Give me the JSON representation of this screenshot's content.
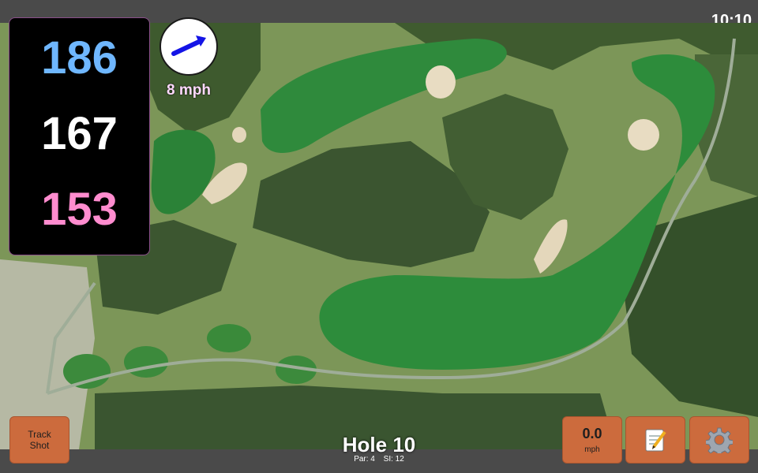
{
  "status": {
    "time": "10:10"
  },
  "distances": {
    "back": "186",
    "middle": "167",
    "front": "153",
    "back_color": "#6fb7ff",
    "middle_color": "#ffffff",
    "front_color": "#ff8ccf"
  },
  "wind": {
    "speed": "8 mph",
    "direction_icon": "arrow-up-right-icon",
    "arrow_color": "#1414e6"
  },
  "map": {
    "type": "satellite-golf-hole",
    "features": [
      "fairway",
      "green",
      "bunker",
      "trees",
      "cart-path"
    ]
  },
  "buttons": {
    "track_shot": {
      "line1": "Track",
      "line2": "Shot"
    },
    "speed": {
      "value": "0.0",
      "unit": "mph"
    },
    "notes": {
      "icon": "notepad-icon"
    },
    "settings": {
      "icon": "gear-icon"
    }
  },
  "hole": {
    "title": "Hole 10",
    "par": "Par: 4",
    "stroke_index": "SI: 12"
  },
  "colors": {
    "button_bg": "#cc6b3d",
    "panel_bg": "#000000",
    "bar_bg": "#4a4a4a"
  }
}
